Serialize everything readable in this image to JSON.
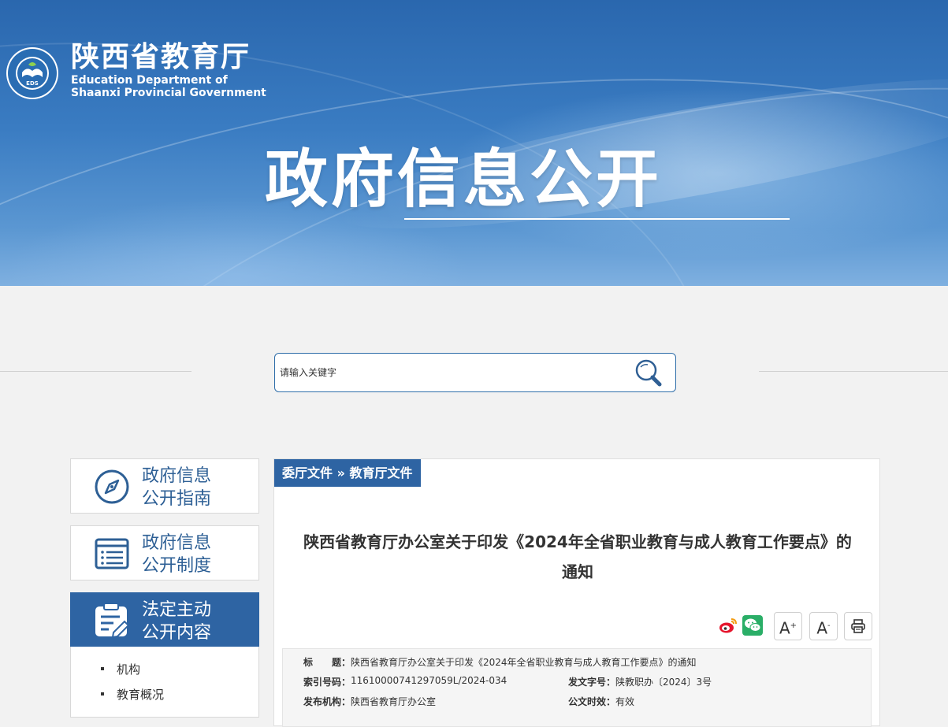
{
  "header": {
    "site_name": "陕西省教育厅",
    "site_name_en_line1": "Education Department of",
    "site_name_en_line2": "Shaanxi Provincial Government",
    "logo_text": "EDS",
    "banner_title": "政府信息公开"
  },
  "search": {
    "placeholder": "请输入关键字"
  },
  "sidebar": {
    "items": [
      {
        "line1": "政府信息",
        "line2": "公开指南",
        "icon": "compass-icon"
      },
      {
        "line1": "政府信息",
        "line2": "公开制度",
        "icon": "list-icon"
      },
      {
        "line1": "法定主动",
        "line2": "公开内容",
        "icon": "clipboard-edit-icon"
      }
    ],
    "sub_items": [
      "机构",
      "教育概况"
    ]
  },
  "breadcrumb": {
    "level1": "委厅文件",
    "sep": "»",
    "level2": "教育厅文件"
  },
  "article": {
    "title_line1": "陕西省教育厅办公室关于印发《2024年全省职业教育与成人教育工作要点》的",
    "title_line2": "通知"
  },
  "toolbar": {
    "font_increase": "A",
    "font_decrease": "A",
    "share_weibo": "weibo-icon",
    "share_wechat": "wechat-icon",
    "print": "print-icon"
  },
  "meta": {
    "title_label": "标　　题：",
    "title_value": "陕西省教育厅办公室关于印发《2024年全省职业教育与成人教育工作要点》的通知",
    "index_label": "索引号码：",
    "index_value": "11610000741297059L/2024-034",
    "doc_no_label": "发文字号：",
    "doc_no_value": "陕教职办〔2024〕3号",
    "issuer_label": "发布机构：",
    "issuer_value": "陕西省教育厅办公室",
    "validity_label": "公文时效：",
    "validity_value": "有效"
  },
  "colors": {
    "brand_blue": "#2e64a3",
    "banner_blue": "#3a7cc2"
  }
}
